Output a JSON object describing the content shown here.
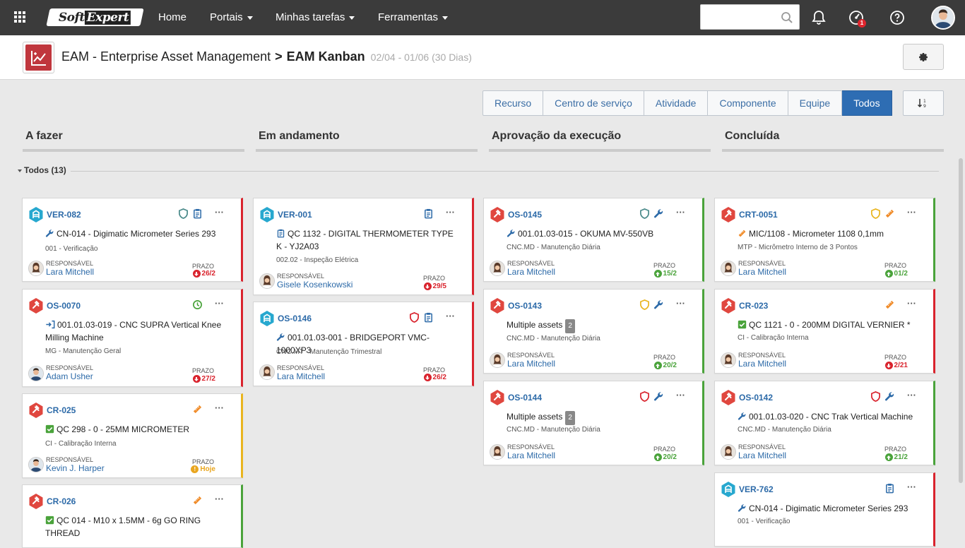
{
  "topbar": {
    "logo_a": "Soft",
    "logo_b": "Expert",
    "nav": [
      {
        "label": "Home"
      },
      {
        "label": "Portais"
      },
      {
        "label": "Minhas tarefas"
      },
      {
        "label": "Ferramentas"
      }
    ],
    "search_placeholder": "",
    "notification_badge": "1"
  },
  "header": {
    "app": "EAM - Enterprise Asset Management",
    "separator": ">",
    "page": "EAM Kanban",
    "dates": "02/04 - 01/06 (30 Dias)"
  },
  "tabs": [
    {
      "label": "Recurso",
      "active": false
    },
    {
      "label": "Centro de serviço",
      "active": false
    },
    {
      "label": "Atividade",
      "active": false
    },
    {
      "label": "Componente",
      "active": false
    },
    {
      "label": "Equipe",
      "active": false
    },
    {
      "label": "Todos",
      "active": true
    }
  ],
  "columns": [
    {
      "title": "A fazer"
    },
    {
      "title": "Em andamento"
    },
    {
      "title": "Aprovação da execução"
    },
    {
      "title": "Concluída"
    }
  ],
  "group": {
    "label": "Todos (13)"
  },
  "labels": {
    "responsavel": "RESPONSÁVEL",
    "prazo": "PRAZO",
    "more": "···"
  },
  "colors": {
    "accent": "#2e6db3",
    "late": "#d9232d",
    "ok": "#4aa33b",
    "today": "#e9b51f",
    "brand": "#c0363d"
  },
  "cards": [
    {
      "code": "VER-082",
      "title": "CN-014 - Digimatic Micrometer Series 293",
      "sub": "001 - Verificação",
      "resp": "Lara Mitchell",
      "prazo": "26/2"
    },
    {
      "code": "OS-0070",
      "title": "001.01.03-019 - CNC SUPRA Vertical Knee Milling Machine",
      "sub": "MG - Manutenção Geral",
      "resp": "Adam Usher",
      "prazo": "27/2"
    },
    {
      "code": "CR-025",
      "title": "QC 298 - 0 - 25MM MICROMETER",
      "sub": "CI - Calibração Interna",
      "resp": "Kevin J. Harper",
      "prazo": "Hoje"
    },
    {
      "code": "CR-026",
      "title": "QC 014 - M10 x 1.5MM - 6g GO RING THREAD",
      "sub": "",
      "resp": "",
      "prazo": ""
    },
    {
      "code": "VER-001",
      "title": "QC 1132 - DIGITAL THERMOMETER TYPE K - YJ2A03",
      "sub": "002.02 - Inspeção Elétrica",
      "resp": "Gisele Kosenkowski",
      "prazo": "29/5"
    },
    {
      "code": "OS-0146",
      "title": "001.01.03-001 - BRIDGEPORT VMC-1000XP3",
      "sub": "CNC.MT - Manutenção Trimestral",
      "resp": "Lara Mitchell",
      "prazo": "26/2"
    },
    {
      "code": "OS-0145",
      "title": "001.01.03-015 - OKUMA MV-550VB",
      "sub": "CNC.MD - Manutenção Diária",
      "resp": "Lara Mitchell",
      "prazo": "15/2"
    },
    {
      "code": "OS-0143",
      "title": "Multiple assets",
      "count": "2",
      "sub": "CNC.MD - Manutenção Diária",
      "resp": "Lara Mitchell",
      "prazo": "20/2"
    },
    {
      "code": "OS-0144",
      "title": "Multiple assets",
      "count": "2",
      "sub": "CNC.MD - Manutenção Diária",
      "resp": "Lara Mitchell",
      "prazo": "20/2"
    },
    {
      "code": "CRT-0051",
      "title": "MIC/1108 - Micrometer 1108 0,1mm",
      "sub": "MTP - Micrômetro Interno de 3 Pontos",
      "resp": "Lara Mitchell",
      "prazo": "01/2"
    },
    {
      "code": "CR-023",
      "title": "QC 1121 - 0 - 200MM DIGITAL VERNIER *",
      "sub": "CI - Calibração Interna",
      "resp": "Lara Mitchell",
      "prazo": "2/21"
    },
    {
      "code": "OS-0142",
      "title": "001.01.03-020 - CNC Trak Vertical Machine",
      "sub": "CNC.MD - Manutenção Diária",
      "resp": "Lara Mitchell",
      "prazo": "21/2"
    },
    {
      "code": "VER-762",
      "title": "CN-014 - Digimatic Micrometer Series 293",
      "sub": "001 - Verificação",
      "resp": "",
      "prazo": ""
    }
  ]
}
